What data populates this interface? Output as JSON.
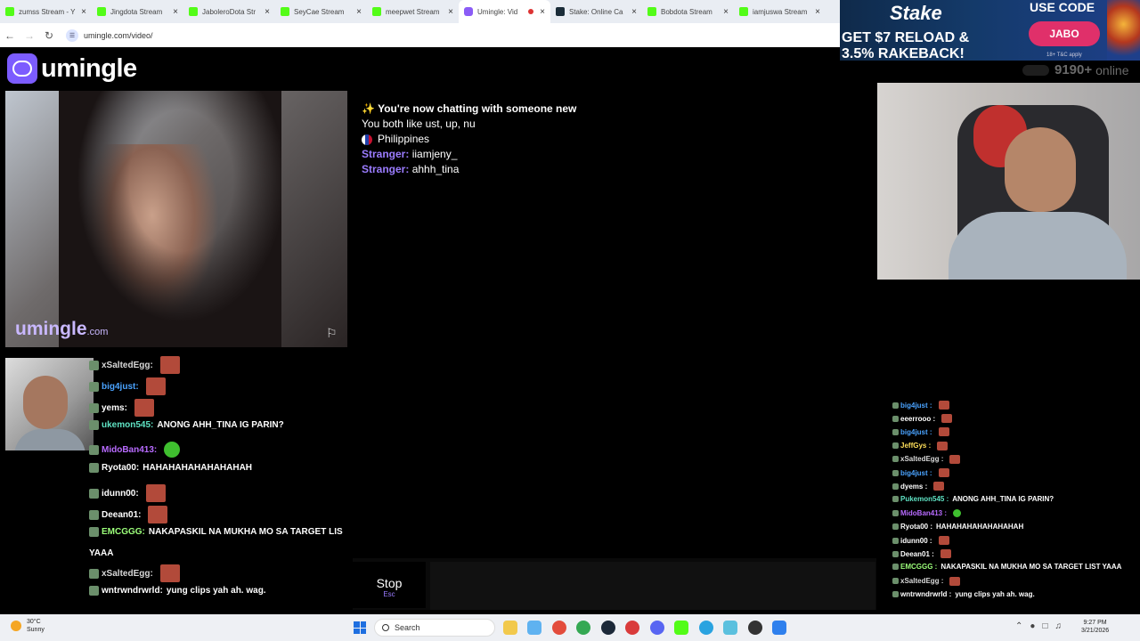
{
  "browser": {
    "tabs": [
      {
        "title": "zumss Stream - Y",
        "fav": "kick"
      },
      {
        "title": "Jingdota Stream",
        "fav": "kick"
      },
      {
        "title": "JaboleroDota Str",
        "fav": "kick"
      },
      {
        "title": "SeyCae Stream",
        "fav": "kick"
      },
      {
        "title": "meepwet Stream",
        "fav": "kick"
      },
      {
        "title": "Umingle: Vid",
        "fav": "umingle",
        "active": true,
        "recording": true
      },
      {
        "title": "Stake: Online Ca",
        "fav": "stake"
      },
      {
        "title": "Bobdota Stream",
        "fav": "kick"
      },
      {
        "title": "iamjuswa Stream",
        "fav": "kick"
      }
    ],
    "url": "umingle.com/video/"
  },
  "banner": {
    "brand": "Stake",
    "promo_line1": "GET $7 RELOAD &",
    "promo_line2": "3.5% RAKEBACK!",
    "code_label": "USE CODE",
    "code": "JABO",
    "fine_print": "18+ T&C apply"
  },
  "site": {
    "logo_text": "umingle",
    "online_count": "9190+",
    "online_label": "online",
    "watermark": "umingle",
    "watermark_suffix": ".com"
  },
  "chat": {
    "system_icon": "✨",
    "system_message": "You're now chatting with someone new",
    "interests": "You both like ust, up, nu",
    "country": "Philippines",
    "messages": [
      {
        "sender": "Stranger:",
        "text": "iiamjeny_"
      },
      {
        "sender": "Stranger:",
        "text": "ahhh_tina"
      }
    ],
    "stop_label": "Stop",
    "stop_shortcut": "Esc"
  },
  "kick_chat_left": [
    {
      "user": "xSaltedEgg:",
      "color": "#d8d8d8",
      "text": "",
      "emote": "red"
    },
    {
      "user": "big4just:",
      "color": "#4aa3ff",
      "text": "",
      "emote": "red"
    },
    {
      "user": "yems:",
      "color": "#ffffff",
      "text": "",
      "emote": "red"
    },
    {
      "user": "ukemon545:",
      "color": "#5fe3c4",
      "text": "ANONG AHH_TINA IG PARIN?",
      "emote": ""
    },
    {
      "user": "MidoBan413:",
      "color": "#b86bff",
      "text": "",
      "emote": "green"
    },
    {
      "user": "Ryota00:",
      "color": "#ffffff",
      "text": "HAHAHAHAHAHAHAHAH",
      "emote": ""
    },
    {
      "user": "idunn00:",
      "color": "#ffffff",
      "text": "",
      "emote": "red"
    },
    {
      "user": "Deean01:",
      "color": "#ffffff",
      "text": "",
      "emote": "red"
    },
    {
      "user": "EMCGGG:",
      "color": "#9cff7a",
      "text": "NAKAPASKIL NA MUKHA MO SA TARGET LIS",
      "emote": ""
    },
    {
      "user": "",
      "color": "#ffffff",
      "text": "YAAA",
      "emote": ""
    },
    {
      "user": "xSaltedEgg:",
      "color": "#d8d8d8",
      "text": "",
      "emote": "red"
    },
    {
      "user": "wntrwndrwrld:",
      "color": "#ffffff",
      "text": "yung clips yah ah. wag.",
      "emote": ""
    }
  ],
  "kick_chat_right": [
    {
      "user": "big4just :",
      "color": "#4aa3ff",
      "text": "",
      "emote": "red"
    },
    {
      "user": "eeerrooo :",
      "color": "#ffffff",
      "text": "",
      "emote": "red"
    },
    {
      "user": "big4just :",
      "color": "#4aa3ff",
      "text": "",
      "emote": "red"
    },
    {
      "user": "JeffGys :",
      "color": "#ffdf5a",
      "text": "",
      "emote": "red"
    },
    {
      "user": "xSaltedEgg :",
      "color": "#d8d8d8",
      "text": "",
      "emote": "red"
    },
    {
      "user": "big4just :",
      "color": "#4aa3ff",
      "text": "",
      "emote": "red"
    },
    {
      "user": "dyems :",
      "color": "#ffffff",
      "text": "",
      "emote": "red"
    },
    {
      "user": "Pukemon545 :",
      "color": "#5fe3c4",
      "text": "ANONG AHH_TINA IG PARIN?",
      "emote": ""
    },
    {
      "user": "MidoBan413 :",
      "color": "#b86bff",
      "text": "",
      "emote": "green"
    },
    {
      "user": "Ryota00 :",
      "color": "#ffffff",
      "text": "HAHAHAHAHAHAHAHAH",
      "emote": ""
    },
    {
      "user": "idunn00 :",
      "color": "#ffffff",
      "text": "",
      "emote": "red"
    },
    {
      "user": "Deean01 :",
      "color": "#ffffff",
      "text": "",
      "emote": "red"
    },
    {
      "user": "EMCGGG :",
      "color": "#9cff7a",
      "text": "NAKAPASKIL NA MUKHA MO SA TARGET LIST YAAA",
      "emote": ""
    },
    {
      "user": "xSaltedEgg :",
      "color": "#d8d8d8",
      "text": "",
      "emote": "red"
    },
    {
      "user": "wntrwndrwrld :",
      "color": "#ffffff",
      "text": "yung clips yah ah. wag.",
      "emote": ""
    }
  ],
  "taskbar": {
    "temperature": "30°C",
    "weather": "Sunny",
    "search_placeholder": "Search",
    "time": "9:27 PM",
    "date": "3/21/2026"
  }
}
